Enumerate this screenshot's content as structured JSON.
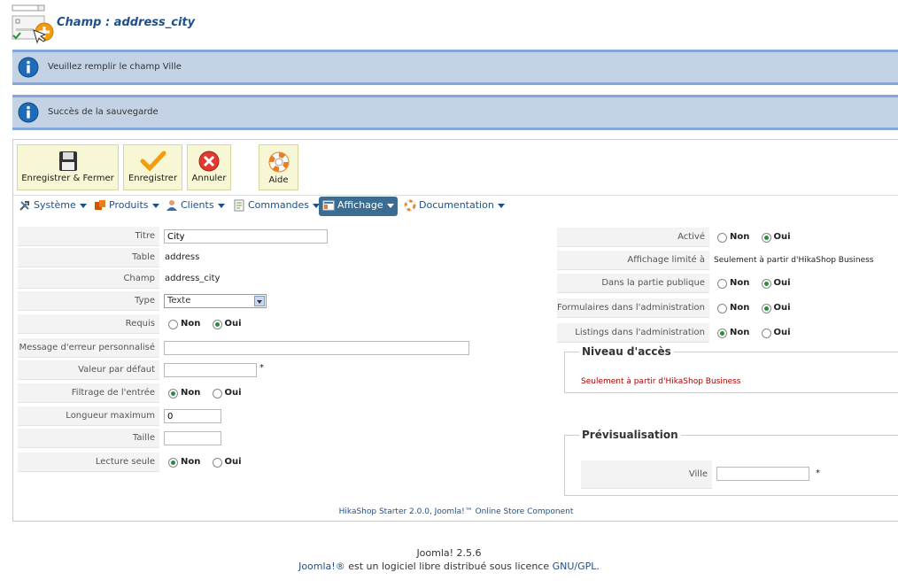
{
  "header": {
    "title": "Champ : address_city",
    "icon": "field-add-icon"
  },
  "messages": [
    {
      "text": "Veuillez remplir le champ Ville",
      "icon": "info-icon"
    },
    {
      "text": "Succès de la sauvegarde",
      "icon": "info-icon"
    }
  ],
  "toolbar": {
    "save_close": "Enregistrer & Fermer",
    "save": "Enregistrer",
    "cancel": "Annuler",
    "help": "Aide"
  },
  "menu": {
    "items": [
      {
        "label": "Système",
        "icon": "tools-icon"
      },
      {
        "label": "Produits",
        "icon": "products-icon"
      },
      {
        "label": "Clients",
        "icon": "clients-icon"
      },
      {
        "label": "Commandes",
        "icon": "orders-icon"
      },
      {
        "label": "Affichage",
        "icon": "display-icon"
      },
      {
        "label": "Documentation",
        "icon": "lifebuoy-icon"
      }
    ]
  },
  "form_left": {
    "titre": {
      "label": "Titre",
      "value": "City"
    },
    "table": {
      "label": "Table",
      "value": "address"
    },
    "champ": {
      "label": "Champ",
      "value": "address_city"
    },
    "type": {
      "label": "Type",
      "value": "Texte"
    },
    "requis": {
      "label": "Requis",
      "no": "Non",
      "yes": "Oui"
    },
    "message": {
      "label": "Message d'erreur personnalisé",
      "value": ""
    },
    "default": {
      "label": "Valeur par défaut",
      "value": "",
      "star": "*"
    },
    "filter": {
      "label": "Filtrage de l'entrée",
      "no": "Non",
      "yes": "Oui"
    },
    "maxlen": {
      "label": "Longueur maximum",
      "value": "0"
    },
    "size": {
      "label": "Taille",
      "value": ""
    },
    "readonly": {
      "label": "Lecture seule",
      "no": "Non",
      "yes": "Oui"
    }
  },
  "form_right": {
    "active": {
      "label": "Activé",
      "no": "Non",
      "yes": "Oui"
    },
    "limited": {
      "label": "Affichage limité à",
      "value": "Seulement à partir d'HikaShop Business"
    },
    "public": {
      "label": "Dans la partie publique",
      "no": "Non",
      "yes": "Oui"
    },
    "admin_forms": {
      "label": "Formulaires dans l'administration",
      "no": "Non",
      "yes": "Oui"
    },
    "admin_lists": {
      "label": "Listings dans l'administration",
      "no": "Non",
      "yes": "Oui"
    }
  },
  "access": {
    "legend": "Niveau d'accès",
    "text": "Seulement à partir d'HikaShop Business"
  },
  "preview": {
    "legend": "Prévisualisation",
    "label": "Ville",
    "value": "",
    "star": "*"
  },
  "footer": {
    "component": "HikaShop Starter 2.0.0, Joomla!™ Online Store Component",
    "version": "Joomla! 2.5.6",
    "joomla_link": "Joomla!®",
    "license_text": " est un logiciel libre distribué sous licence ",
    "gpl_link": "GNU/GPL",
    "period": "."
  }
}
